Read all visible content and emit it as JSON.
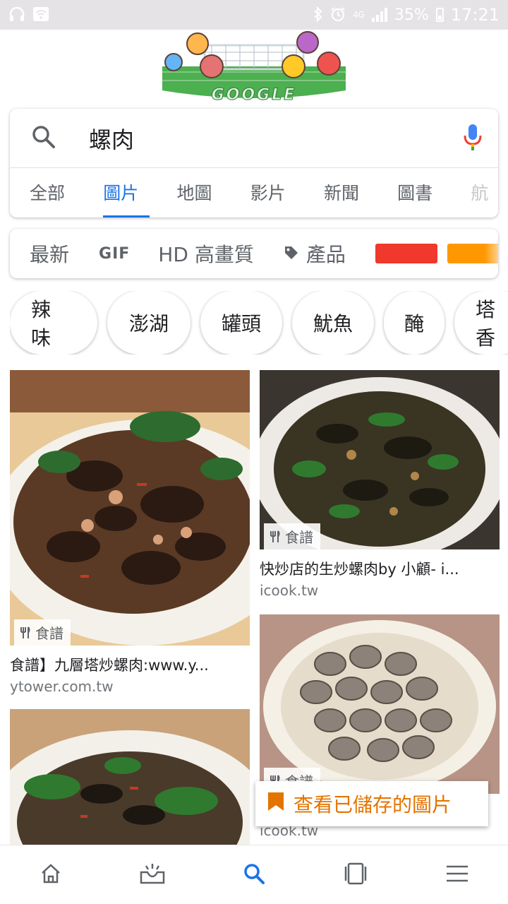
{
  "status_bar": {
    "battery": "35%",
    "time": "17:21",
    "network": "4G"
  },
  "doodle": {
    "text": "GOOGLE"
  },
  "search": {
    "query": "螺肉"
  },
  "tabs": [
    {
      "label": "全部"
    },
    {
      "label": "圖片",
      "active": true
    },
    {
      "label": "地圖"
    },
    {
      "label": "影片"
    },
    {
      "label": "新聞"
    },
    {
      "label": "圖書"
    },
    {
      "label": "航"
    }
  ],
  "filters": {
    "latest": "最新",
    "gif": "GIF",
    "hd": "HD 高畫質",
    "products": "產品",
    "colors": [
      "#f0382c",
      "#ff9800"
    ]
  },
  "chips": [
    "辣 味",
    "澎湖",
    "罐頭",
    "魷魚",
    "醃",
    "塔 香"
  ],
  "results": [
    {
      "tag": "食譜",
      "caption": "食譜】九層塔炒螺肉:www.y...",
      "domain": "ytower.com.tw"
    },
    {
      "tag": "食譜",
      "caption": "快炒店的生炒螺肉by 小顧- i...",
      "domain": "icook.tw"
    },
    {
      "tag": "",
      "caption": "",
      "domain": ""
    },
    {
      "tag": "食譜",
      "caption": "",
      "domain": "icook.tw"
    }
  ],
  "saved_button": {
    "label": "查看已儲存的圖片"
  },
  "colors": {
    "accent": "#1a73e8",
    "saved": "#e37400"
  }
}
